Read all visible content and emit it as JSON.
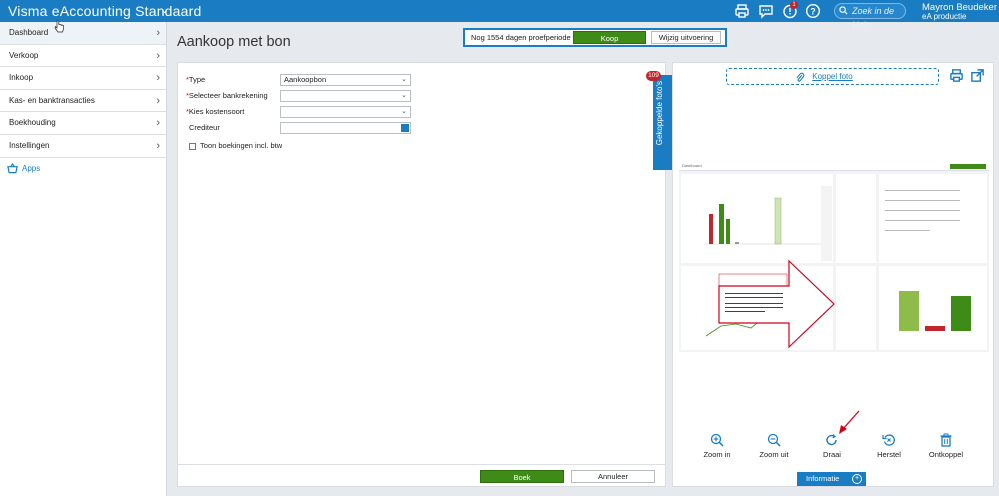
{
  "topbar": {
    "app_title": "Visma eAccounting Standaard",
    "search_placeholder": "Zoek in de Help",
    "user_name": "Mayron Beudeker",
    "user_org": "eA productie",
    "notification_count": "1"
  },
  "sidebar": {
    "items": [
      {
        "label": "Dashboard"
      },
      {
        "label": "Verkoop"
      },
      {
        "label": "Inkoop"
      },
      {
        "label": "Kas- en banktransacties"
      },
      {
        "label": "Boekhouding"
      },
      {
        "label": "Instellingen"
      }
    ],
    "apps_label": "Apps"
  },
  "trial": {
    "text": "Nog 1554 dagen proefperiode",
    "buy_label": "Koop",
    "change_label": "Wijzig uitvoering"
  },
  "page": {
    "title": "Aankoop met bon"
  },
  "form": {
    "type_label": "Type",
    "type_value": "Aankoopbon",
    "bank_label": "Selecteer bankrekening",
    "cost_label": "Kies kostensoort",
    "creditor_label": "Crediteur",
    "vat_checkbox_label": "Toon boekingen incl. btw",
    "save_label": "Boek",
    "cancel_label": "Annuleer"
  },
  "photos": {
    "tab_label": "Gekoppelde foto's",
    "badge_count": "109",
    "link_label": "Koppel foto",
    "preview_header": "Dashboard",
    "controls": [
      {
        "label": "Zoom in",
        "icon": "zoom-in-icon"
      },
      {
        "label": "Zoom uit",
        "icon": "zoom-out-icon"
      },
      {
        "label": "Draai",
        "icon": "rotate-icon"
      },
      {
        "label": "Herstel",
        "icon": "reset-icon"
      },
      {
        "label": "Ontkoppel",
        "icon": "trash-icon"
      }
    ],
    "info_label": "Informatie"
  },
  "colors": {
    "accent": "#1a7dc4",
    "primary_button": "#3e8b17",
    "badge": "#c0262d",
    "annotation": "#d0021b"
  }
}
